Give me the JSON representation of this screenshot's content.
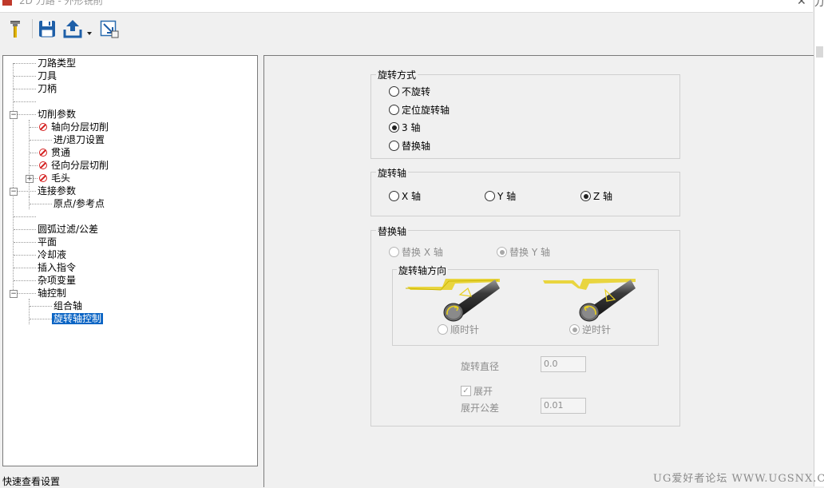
{
  "window": {
    "title": "2D 刀路 - 外形铣削",
    "close_glyph": "✕"
  },
  "right_strip_text": "刀具",
  "toolbar": {
    "items": [
      {
        "name": "tool-icon"
      },
      {
        "name": "save-icon"
      },
      {
        "name": "export-icon"
      },
      {
        "name": "dropdown-arrow-icon"
      },
      {
        "name": "auto-display-icon"
      }
    ]
  },
  "tree": {
    "items": [
      {
        "label": "刀路类型"
      },
      {
        "label": "刀具"
      },
      {
        "label": "刀柄"
      },
      {
        "label": "切削参数",
        "expander": "−"
      },
      {
        "label": "轴向分层切削",
        "error": true
      },
      {
        "label": "进/退刀设置"
      },
      {
        "label": "贯通",
        "error": true
      },
      {
        "label": "径向分层切削",
        "error": true
      },
      {
        "label": "毛头",
        "error": true,
        "expander": "+"
      },
      {
        "label": "连接参数",
        "expander": "−"
      },
      {
        "label": "原点/参考点"
      },
      {
        "label": "圆弧过滤/公差"
      },
      {
        "label": "平面"
      },
      {
        "label": "冷却液"
      },
      {
        "label": "插入指令"
      },
      {
        "label": "杂项变量"
      },
      {
        "label": "轴控制",
        "expander": "−"
      },
      {
        "label": "组合轴"
      },
      {
        "label": "旋转轴控制",
        "selected": true
      }
    ]
  },
  "status": {
    "text": "快速查看设置"
  },
  "rotation_mode": {
    "title": "旋转方式",
    "options": [
      {
        "label": "不旋转",
        "checked": false
      },
      {
        "label": "定位旋转轴",
        "checked": false
      },
      {
        "label": "3 轴",
        "checked": true
      },
      {
        "label": "替换轴",
        "checked": false
      }
    ]
  },
  "rotation_axis": {
    "title": "旋转轴",
    "options": [
      {
        "label": "X 轴",
        "checked": false
      },
      {
        "label": "Y 轴",
        "checked": false
      },
      {
        "label": "Z 轴",
        "checked": true
      }
    ]
  },
  "replace_axis": {
    "title": "替换轴",
    "options": [
      {
        "label": "替换 X 轴",
        "checked": false
      },
      {
        "label": "替换 Y 轴",
        "checked": true
      }
    ],
    "direction": {
      "title": "旋转轴方向",
      "options": [
        {
          "label": "顺时针",
          "checked": false
        },
        {
          "label": "逆时针",
          "checked": true
        }
      ]
    },
    "diameter_label": "旋转直径",
    "diameter_value": "0.0",
    "unroll_label": "展开",
    "unroll_checked": true,
    "unroll_tol_label": "展开公差",
    "unroll_tol_value": "0.01"
  },
  "watermark": "UG爱好者论坛 WWW.UGSNX.COM",
  "colors": {
    "selection": "#0a64c4",
    "error": "#d42020",
    "save_icon": "#1e5fa8",
    "toolpath_yellow": "#e8d020"
  }
}
